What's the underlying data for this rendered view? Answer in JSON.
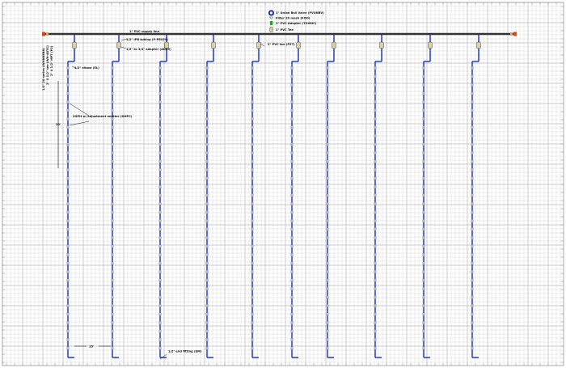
{
  "legend": {
    "items": [
      {
        "icon": "blue-circle-icon",
        "label": "1\" Union Ball Valve (PVUNBV)"
      },
      {
        "icon": "filter-icon",
        "label": "Filter 20 mesh (FI90)"
      },
      {
        "icon": "green-adapter-icon",
        "label": "1\" PVC Adapter (TOGMC)"
      },
      {
        "icon": "tee-icon",
        "label": "1\" PVC Tee"
      }
    ]
  },
  "labels": {
    "supply_line": "1\" PVC supply line",
    "tubing": "1/2\" IPB tubing (P-PE029)",
    "adapter": "1/2\" to 3/4\" adapter (ADB9)",
    "tee": "1\" PVC tee (P27)",
    "elbow": "1/2\" elbow (EL)",
    "emitter": "2GPH w/ adjustment emitter (DHPC)",
    "end_fitting": "1/2\" end fitting (EM)",
    "spacing_20": "20'",
    "spacing_15": "15'",
    "vertical_head": "1/2\" 20 series (WHN88B8)",
    "vertical_mid": "2\" X 1/2\" tee (WH-48TC)",
    "vertical_tail": "2\" X 1/2\" MPT (P2)"
  },
  "colors": {
    "grid": "#c8c8c8",
    "supply": "#333333",
    "lateral": "#1530c8",
    "emitter": "#bbbbbb",
    "tee": "#d8d2a8",
    "valve": "#d24a1c",
    "adapter": "#2a9a3a"
  }
}
